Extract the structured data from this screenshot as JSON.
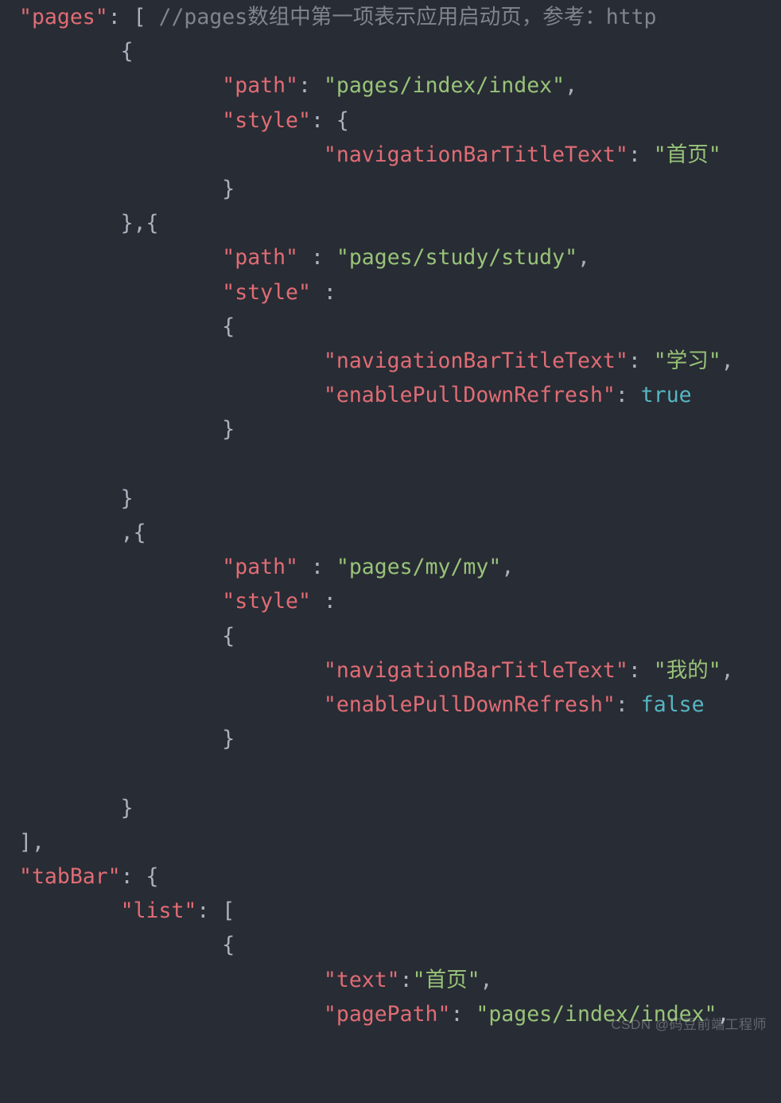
{
  "code": {
    "lines": [
      {
        "indent": 0,
        "tokens": [
          {
            "t": "k",
            "v": "\"pages\""
          },
          {
            "t": "p",
            "v": ": [ "
          },
          {
            "t": "c",
            "v": "//pages数组中第一项表示应用启动页，参考：http"
          }
        ]
      },
      {
        "indent": 2,
        "tokens": [
          {
            "t": "p",
            "v": "{"
          }
        ]
      },
      {
        "indent": 4,
        "tokens": [
          {
            "t": "k",
            "v": "\"path\""
          },
          {
            "t": "p",
            "v": ": "
          },
          {
            "t": "s",
            "v": "\"pages/index/index\""
          },
          {
            "t": "p",
            "v": ","
          }
        ]
      },
      {
        "indent": 4,
        "tokens": [
          {
            "t": "k",
            "v": "\"style\""
          },
          {
            "t": "p",
            "v": ": {"
          }
        ]
      },
      {
        "indent": 6,
        "tokens": [
          {
            "t": "k",
            "v": "\"navigationBarTitleText\""
          },
          {
            "t": "p",
            "v": ": "
          },
          {
            "t": "s",
            "v": "\"首页\""
          }
        ]
      },
      {
        "indent": 4,
        "tokens": [
          {
            "t": "p",
            "v": "}"
          }
        ]
      },
      {
        "indent": 2,
        "tokens": [
          {
            "t": "p",
            "v": "},{"
          }
        ]
      },
      {
        "indent": 4,
        "tokens": [
          {
            "t": "k",
            "v": "\"path\""
          },
          {
            "t": "p",
            "v": " : "
          },
          {
            "t": "s",
            "v": "\"pages/study/study\""
          },
          {
            "t": "p",
            "v": ","
          }
        ]
      },
      {
        "indent": 4,
        "tokens": [
          {
            "t": "k",
            "v": "\"style\""
          },
          {
            "t": "p",
            "v": " :"
          }
        ]
      },
      {
        "indent": 4,
        "tokens": [
          {
            "t": "p",
            "v": "{"
          }
        ]
      },
      {
        "indent": 6,
        "tokens": [
          {
            "t": "k",
            "v": "\"navigationBarTitleText\""
          },
          {
            "t": "p",
            "v": ": "
          },
          {
            "t": "s",
            "v": "\"学习\""
          },
          {
            "t": "p",
            "v": ","
          }
        ]
      },
      {
        "indent": 6,
        "tokens": [
          {
            "t": "k",
            "v": "\"enablePullDownRefresh\""
          },
          {
            "t": "p",
            "v": ": "
          },
          {
            "t": "b",
            "v": "true"
          }
        ]
      },
      {
        "indent": 4,
        "tokens": [
          {
            "t": "p",
            "v": "}"
          }
        ]
      },
      {
        "indent": 0,
        "tokens": [
          {
            "t": "p",
            "v": ""
          }
        ]
      },
      {
        "indent": 2,
        "tokens": [
          {
            "t": "p",
            "v": "}"
          }
        ]
      },
      {
        "indent": 2,
        "tokens": [
          {
            "t": "p",
            "v": ",{"
          }
        ]
      },
      {
        "indent": 4,
        "tokens": [
          {
            "t": "k",
            "v": "\"path\""
          },
          {
            "t": "p",
            "v": " : "
          },
          {
            "t": "s",
            "v": "\"pages/my/my\""
          },
          {
            "t": "p",
            "v": ","
          }
        ]
      },
      {
        "indent": 4,
        "tokens": [
          {
            "t": "k",
            "v": "\"style\""
          },
          {
            "t": "p",
            "v": " :"
          }
        ]
      },
      {
        "indent": 4,
        "tokens": [
          {
            "t": "p",
            "v": "{"
          }
        ]
      },
      {
        "indent": 6,
        "tokens": [
          {
            "t": "k",
            "v": "\"navigationBarTitleText\""
          },
          {
            "t": "p",
            "v": ": "
          },
          {
            "t": "s",
            "v": "\"我的\""
          },
          {
            "t": "p",
            "v": ","
          }
        ]
      },
      {
        "indent": 6,
        "tokens": [
          {
            "t": "k",
            "v": "\"enablePullDownRefresh\""
          },
          {
            "t": "p",
            "v": ": "
          },
          {
            "t": "b",
            "v": "false"
          }
        ]
      },
      {
        "indent": 4,
        "tokens": [
          {
            "t": "p",
            "v": "}"
          }
        ]
      },
      {
        "indent": 0,
        "tokens": [
          {
            "t": "p",
            "v": ""
          }
        ]
      },
      {
        "indent": 2,
        "tokens": [
          {
            "t": "p",
            "v": "}"
          }
        ]
      },
      {
        "indent": 0,
        "tokens": [
          {
            "t": "p",
            "v": "],"
          }
        ]
      },
      {
        "indent": 0,
        "tokens": [
          {
            "t": "k",
            "v": "\"tabBar\""
          },
          {
            "t": "p",
            "v": ": {"
          }
        ]
      },
      {
        "indent": 2,
        "tokens": [
          {
            "t": "k",
            "v": "\"list\""
          },
          {
            "t": "p",
            "v": ": ["
          }
        ]
      },
      {
        "indent": 4,
        "tokens": [
          {
            "t": "p",
            "v": "{"
          }
        ]
      },
      {
        "indent": 6,
        "tokens": [
          {
            "t": "k",
            "v": "\"text\""
          },
          {
            "t": "p",
            "v": ":"
          },
          {
            "t": "s",
            "v": "\"首页\""
          },
          {
            "t": "p",
            "v": ","
          }
        ]
      },
      {
        "indent": 6,
        "tokens": [
          {
            "t": "k",
            "v": "\"pagePath\""
          },
          {
            "t": "p",
            "v": ": "
          },
          {
            "t": "s",
            "v": "\"pages/index/index\""
          },
          {
            "t": "p",
            "v": ","
          }
        ]
      }
    ]
  },
  "watermark": "CSDN @码豆前端工程师",
  "indent_unit": "    "
}
